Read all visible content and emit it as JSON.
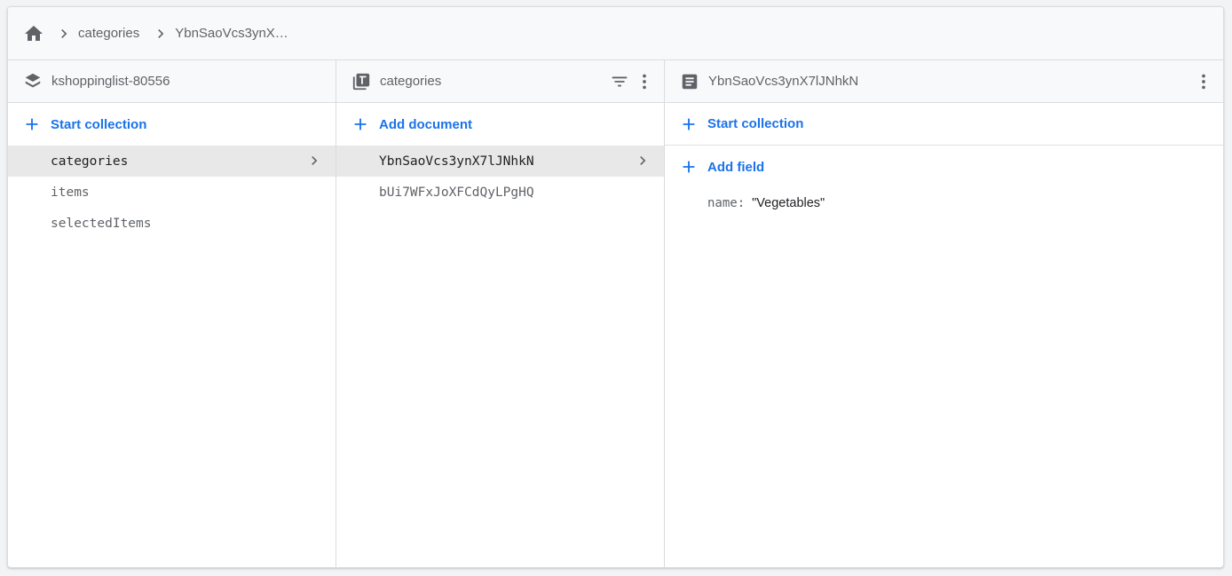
{
  "breadcrumb": {
    "home_icon": "home-icon",
    "segments": [
      "categories",
      "YbnSaoVcs3ynX…"
    ]
  },
  "column1": {
    "header_icon": "database-stack-icon",
    "title": "kshoppinglist-80556",
    "action_label": "Start collection",
    "items": [
      "categories",
      "items",
      "selectedItems"
    ],
    "selected_index": 0
  },
  "column2": {
    "header_icon": "collection-icon",
    "title": "categories",
    "action_label": "Add document",
    "items": [
      "YbnSaoVcs3ynX7lJNhkN",
      "bUi7WFxJoXFCdQyLPgHQ"
    ],
    "selected_index": 0
  },
  "column3": {
    "header_icon": "document-icon",
    "title": "YbnSaoVcs3ynX7lJNhkN",
    "start_collection_label": "Start collection",
    "add_field_label": "Add field",
    "fields": [
      {
        "key": "name",
        "value": "\"Vegetables\""
      }
    ]
  },
  "colors": {
    "accent": "#1a73e8",
    "selected_bg": "#e8e8e8",
    "header_bg": "#f8f9fa"
  }
}
